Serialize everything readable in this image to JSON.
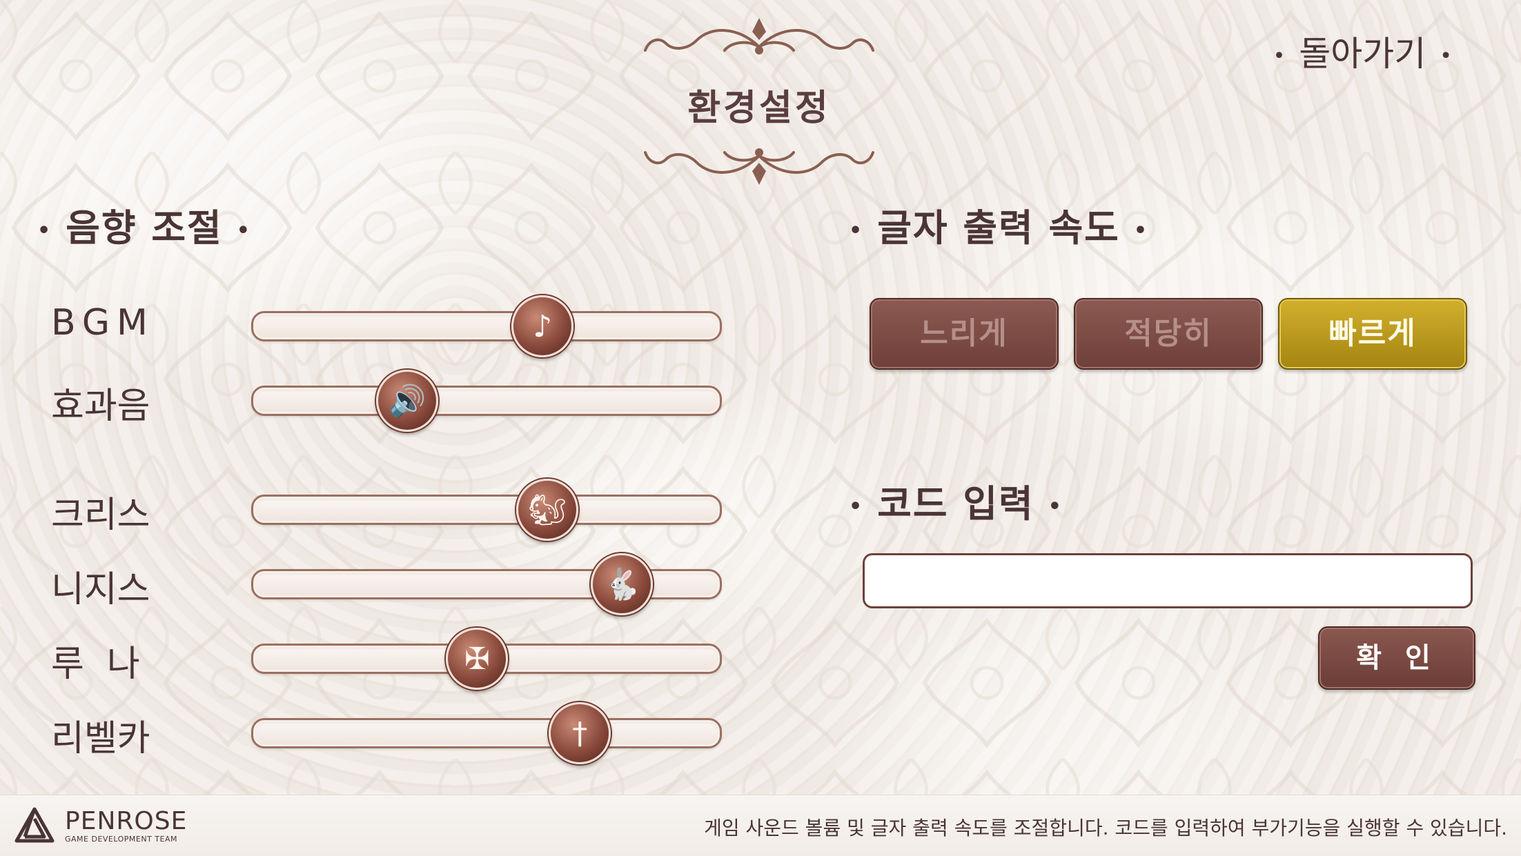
{
  "header": {
    "title": "환경설정",
    "back_label": "돌아가기"
  },
  "sound": {
    "section_title": "음향 조절",
    "sliders": [
      {
        "label": "BGM",
        "icon": "music-note-icon",
        "glyph": "♪",
        "value": 0.62
      },
      {
        "label": "효과음",
        "icon": "speaker-icon",
        "glyph": "🔊",
        "value": 0.33
      },
      {
        "label": "크리스",
        "icon": "squirrel-icon",
        "glyph": "🐿",
        "value": 0.63
      },
      {
        "label": "니지스",
        "icon": "rabbit-icon",
        "glyph": "🐇",
        "value": 0.79
      },
      {
        "label": "루  나",
        "icon": "cross-icon",
        "glyph": "✠",
        "value": 0.48
      },
      {
        "label": "리벨카",
        "icon": "sword-icon",
        "glyph": "†",
        "value": 0.7
      }
    ]
  },
  "text_speed": {
    "section_title": "글자 출력 속도",
    "options": [
      "느리게",
      "적당히",
      "빠르게"
    ],
    "selected": "빠르게"
  },
  "code": {
    "section_title": "코드 입력",
    "input_value": "",
    "confirm_label": "확 인"
  },
  "footer": {
    "logo_name": "PENROSE",
    "logo_sub": "GAME DEVELOPMENT TEAM",
    "description": "게임 사운드 볼륨 및 글자 출력 속도를 조절합니다. 코드를 입력하여 부가기능을 실행할 수 있습니다."
  },
  "colors": {
    "accent_gold": "#c9a623",
    "button_brown": "#7d4d46",
    "text_dark": "#4a3434"
  }
}
